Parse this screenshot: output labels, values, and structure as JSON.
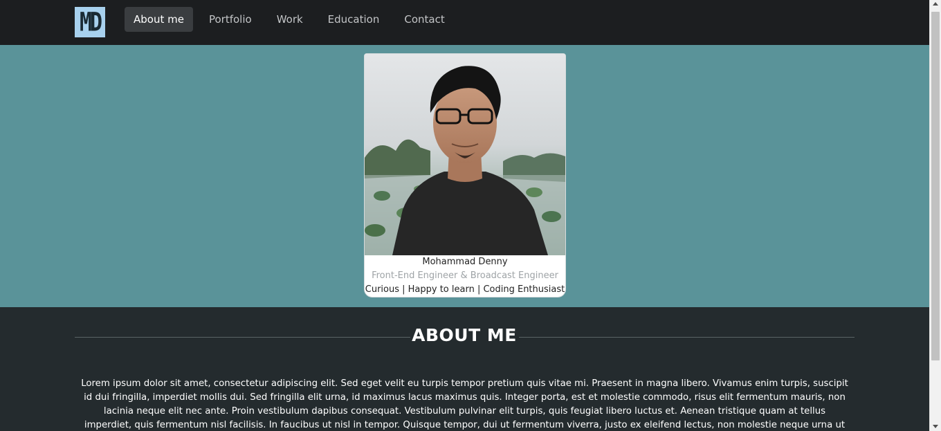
{
  "navbar": {
    "logo": "MD",
    "items": [
      {
        "label": "About me",
        "active": true
      },
      {
        "label": "Portfolio",
        "active": false
      },
      {
        "label": "Work",
        "active": false
      },
      {
        "label": "Education",
        "active": false
      },
      {
        "label": "Contact",
        "active": false
      }
    ]
  },
  "profile": {
    "photo": "portrait-photo",
    "name": "Mohammad Denny",
    "role": "Front-End Engineer & Broadcast Engineer",
    "tagline": "Curious | Happy to learn | Coding Enthusiast"
  },
  "about": {
    "title": "ABOUT ME",
    "text": "Lorem ipsum dolor sit amet, consectetur adipiscing elit. Sed eget velit eu turpis tempor pretium quis vitae mi. Praesent in magna libero. Vivamus enim turpis, suscipit id dui fringilla, imperdiet mollis dui. Sed fringilla elit urna, id maximus lacus maximus quis. Integer porta, est et molestie commodo, risus elit fermentum mauris, non lacinia neque elit nec ante. Proin vestibulum dapibus consequat. Vestibulum pulvinar elit turpis, quis feugiat libero luctus et. Aenean tristique quam at tellus imperdiet, quis fermentum nisl facilisis. In faucibus ut nisl in tempor. Quisque tempor, dui ut fermentum viverra, justo ex eleifend lectus, non molestie neque urna ut enim. Mauris orci massa, ultrices sit amet vulputate ac, tincidunt id mi. Fusce at"
  },
  "colors": {
    "navbar": "#1c1e20",
    "hero": "#5a9399",
    "about": "#242b2e",
    "logo_bg": "#a8d1ee"
  }
}
